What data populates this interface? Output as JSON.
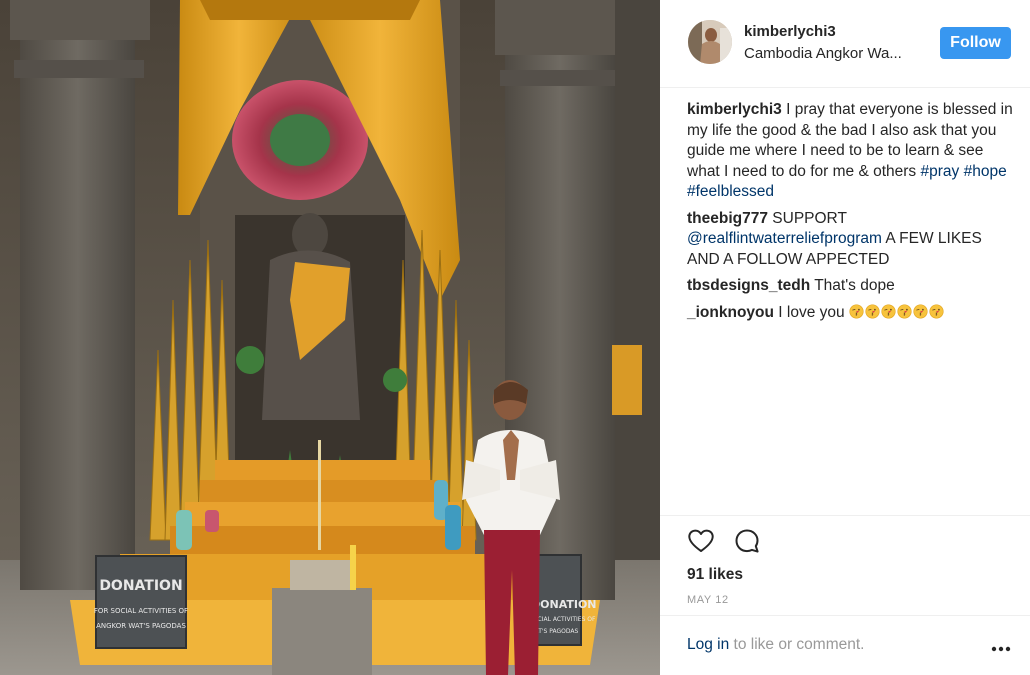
{
  "post": {
    "username": "kimberlychi3",
    "location": "Cambodia Angkor Wa...",
    "follow_label": "Follow",
    "likes": "91 likes",
    "date": "MAY 12",
    "login_link": "Log in",
    "login_suffix": " to like or comment."
  },
  "comments": [
    {
      "author": "kimberlychi3",
      "text": " I pray that everyone is blessed in my life the good & the bad I also ask that you guide me where I need to be to learn & see what I need to do for me & others ",
      "hashtags": [
        "#pray",
        "#hope",
        "#feelblessed"
      ]
    },
    {
      "author": "theebig777",
      "text_before": " SUPPORT ",
      "mention": "@realflintwaterreliefprogram",
      "text_after": " A FEW LIKES AND A FOLLOW APPECTED"
    },
    {
      "author": "tbsdesigns_tedh",
      "text": " That's dope"
    },
    {
      "author": "_ionknoyou",
      "text": " I love you ",
      "emoji": [
        "kissing-face",
        "kissing-face",
        "kissing-face",
        "kissing-face",
        "kissing-face",
        "kissing-face"
      ]
    }
  ],
  "image": {
    "donation_sign_left": [
      "DONATION",
      "FOR SOCIAL ACTIVITIES OF",
      "ANGKOR WAT'S PAGODAS"
    ],
    "donation_sign_right": [
      "DONATION",
      "SOCIAL ACTIVITIES OF",
      "WAT'S PAGODAS"
    ]
  },
  "icons": {
    "like": "heart-outline-icon",
    "comment": "speech-bubble-icon",
    "more": "ellipsis-icon"
  },
  "colors": {
    "follow_button": "#3897f0",
    "link": "#003569",
    "muted": "#999999"
  }
}
